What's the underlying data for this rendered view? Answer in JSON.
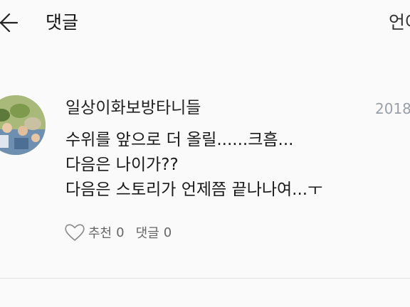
{
  "header": {
    "title": "댓글",
    "lang": "언어"
  },
  "comment": {
    "author": "일상이화보방타니들",
    "timestamp": "2018",
    "lines": [
      "수위를 앞으로 더 올릴......크흠...",
      "다음은 나이가??",
      "다음은 스토리가 언제쯤 끝나나여...ㅜ"
    ],
    "like_label": "추천",
    "like_count": "0",
    "reply_label": "댓글",
    "reply_count": "0"
  },
  "colors": {
    "background": "#fafafa",
    "text": "#1a1a1a",
    "muted": "#666666",
    "timestamp": "#9aa0a8",
    "divider": "#e3e3e3"
  },
  "icons": {
    "back": "back-arrow-icon",
    "like": "heart-outline-icon"
  }
}
